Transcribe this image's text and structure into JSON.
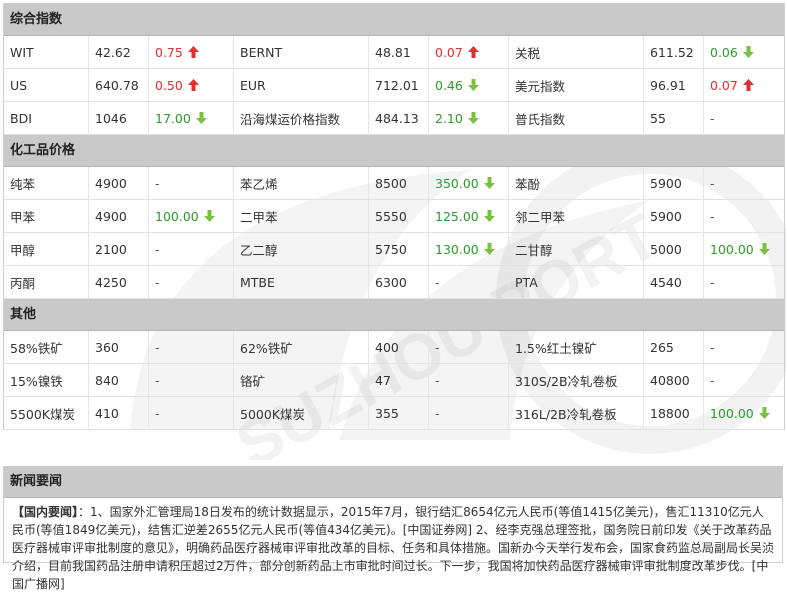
{
  "colors": {
    "up": "#e03030",
    "down": "#2e9a2e",
    "header_bg": "#c9c9c9"
  },
  "watermark": "SUZHOU PORT",
  "sections": [
    {
      "title": "综合指数",
      "rows": [
        [
          {
            "name": "WIT",
            "value": "42.62",
            "change": "0.75",
            "dir": "up"
          },
          {
            "name": "BERNT",
            "value": "48.81",
            "change": "0.07",
            "dir": "up"
          },
          {
            "name": "关税",
            "value": "611.52",
            "change": "0.06",
            "dir": "down"
          }
        ],
        [
          {
            "name": "US",
            "value": "640.78",
            "change": "0.50",
            "dir": "up"
          },
          {
            "name": "EUR",
            "value": "712.01",
            "change": "0.46",
            "dir": "down"
          },
          {
            "name": "美元指数",
            "value": "96.91",
            "change": "0.07",
            "dir": "up"
          }
        ],
        [
          {
            "name": "BDI",
            "value": "1046",
            "change": "17.00",
            "dir": "down"
          },
          {
            "name": "沿海煤运价格指数",
            "value": "484.13",
            "change": "2.10",
            "dir": "down"
          },
          {
            "name": "普氏指数",
            "value": "55",
            "change": "-",
            "dir": "flat"
          }
        ]
      ]
    },
    {
      "title": "化工品价格",
      "rows": [
        [
          {
            "name": "纯苯",
            "value": "4900",
            "change": "-",
            "dir": "flat"
          },
          {
            "name": "苯乙烯",
            "value": "8500",
            "change": "350.00",
            "dir": "down"
          },
          {
            "name": "苯酚",
            "value": "5900",
            "change": "-",
            "dir": "flat"
          }
        ],
        [
          {
            "name": "甲苯",
            "value": "4900",
            "change": "100.00",
            "dir": "down"
          },
          {
            "name": "二甲苯",
            "value": "5550",
            "change": "125.00",
            "dir": "down"
          },
          {
            "name": "邻二甲苯",
            "value": "5900",
            "change": "-",
            "dir": "flat"
          }
        ],
        [
          {
            "name": "甲醇",
            "value": "2100",
            "change": "-",
            "dir": "flat"
          },
          {
            "name": "乙二醇",
            "value": "5750",
            "change": "130.00",
            "dir": "down"
          },
          {
            "name": "二甘醇",
            "value": "5000",
            "change": "100.00",
            "dir": "down"
          }
        ],
        [
          {
            "name": "丙酮",
            "value": "4250",
            "change": "-",
            "dir": "flat"
          },
          {
            "name": "MTBE",
            "value": "6300",
            "change": "-",
            "dir": "flat"
          },
          {
            "name": "PTA",
            "value": "4540",
            "change": "-",
            "dir": "flat"
          }
        ]
      ]
    },
    {
      "title": "其他",
      "rows": [
        [
          {
            "name": "58%铁矿",
            "value": "360",
            "change": "-",
            "dir": "flat"
          },
          {
            "name": "62%铁矿",
            "value": "400",
            "change": "-",
            "dir": "flat"
          },
          {
            "name": "1.5%红土镍矿",
            "value": "265",
            "change": "-",
            "dir": "flat"
          }
        ],
        [
          {
            "name": "15%镍铁",
            "value": "840",
            "change": "-",
            "dir": "flat"
          },
          {
            "name": "铬矿",
            "value": "47",
            "change": "-",
            "dir": "flat"
          },
          {
            "name": "310S/2B冷轧卷板",
            "value": "40800",
            "change": "-",
            "dir": "flat"
          }
        ],
        [
          {
            "name": "5500K煤炭",
            "value": "410",
            "change": "-",
            "dir": "flat"
          },
          {
            "name": "5000K煤炭",
            "value": "355",
            "change": "-",
            "dir": "flat"
          },
          {
            "name": "316L/2B冷轧卷板",
            "value": "18800",
            "change": "100.00",
            "dir": "down"
          }
        ]
      ]
    }
  ],
  "news": {
    "title": "新闻要闻",
    "lead": "【国内要闻】",
    "body": "：1、国家外汇管理局18日发布的统计数据显示，2015年7月，银行结汇8654亿元人民币(等值1415亿美元)，售汇11310亿元人民币(等值1849亿美元)，结售汇逆差2655亿元人民币(等值434亿美元)。[中国证券网] 2、经李克强总理签批，国务院日前印发《关于改革药品医疗器械审评审批制度的意见》，明确药品医疗器械审评审批改革的目标、任务和具体措施。国新办今天举行发布会，国家食药监总局副局长吴浈介绍，目前我国药品注册申请积压超过2万件，部分创新药品上市审批时间过长。下一步，我国将加快药品医疗器械审评审批制度改革步伐。[中国广播网]"
  }
}
